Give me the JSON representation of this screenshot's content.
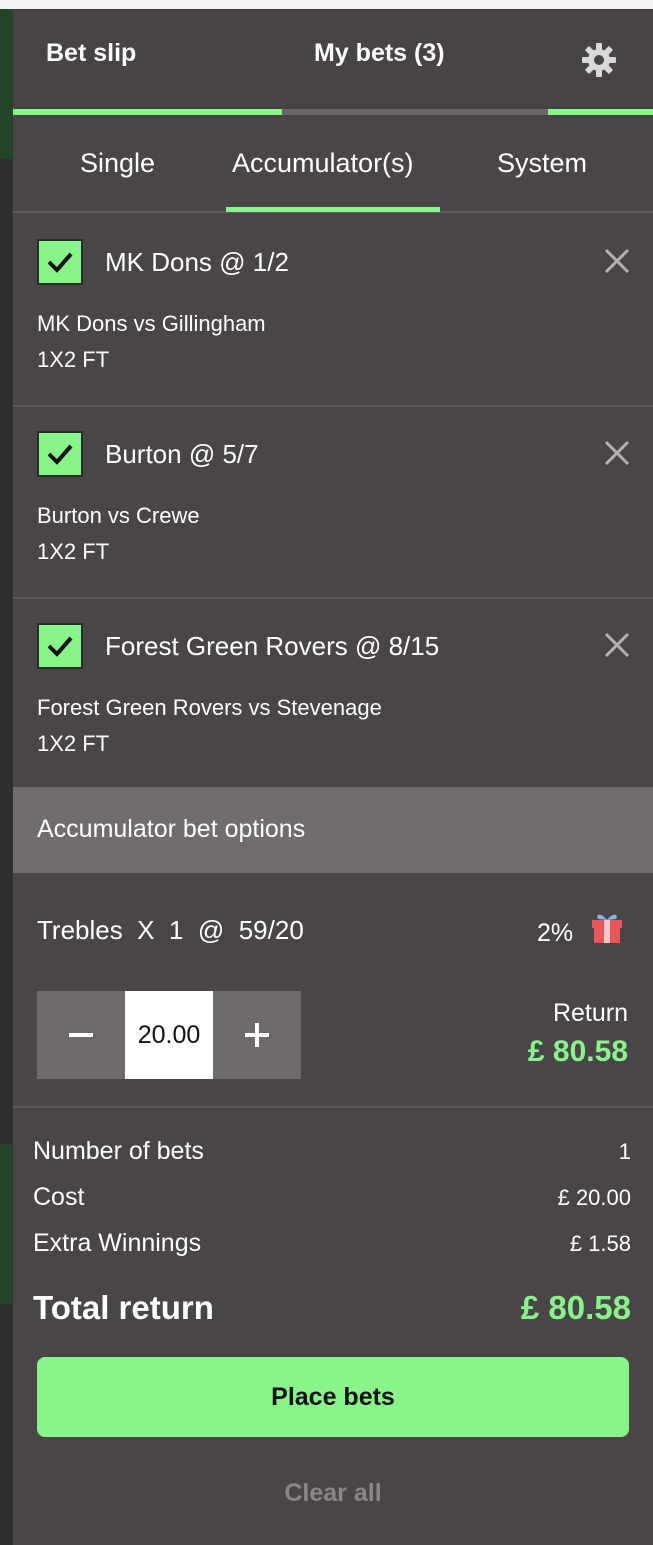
{
  "header": {
    "tab_betslip": "Bet slip",
    "tab_mybets": "My bets (3)",
    "settings_icon": "gear-icon",
    "accent": "#88f58a"
  },
  "subtabs": [
    "Single",
    "Accumulator(s)",
    "System"
  ],
  "selections": [
    {
      "title": "MK Dons @ 1/2",
      "match": "MK Dons vs Gillingham",
      "market": "1X2 FT"
    },
    {
      "title": "Burton @ 5/7",
      "match": "Burton vs Crewe",
      "market": "1X2 FT"
    },
    {
      "title": "Forest Green Rovers @ 8/15",
      "match": "Forest Green Rovers vs Stevenage",
      "market": "1X2 FT"
    }
  ],
  "options": {
    "header": "Accumulator bet options",
    "trebles": "Trebles  X  1  @  59/20",
    "boost_pct": "2%",
    "stake": "20.00",
    "return_label": "Return",
    "return_value": "£ 80.58"
  },
  "summary": {
    "bets_label": "Number of bets",
    "bets_value": "1",
    "cost_label": "Cost",
    "cost_value": "£ 20.00",
    "extra_label": "Extra Winnings",
    "extra_value": "£ 1.58",
    "total_label": "Total return",
    "total_value": "£ 80.58"
  },
  "actions": {
    "place": "Place bets",
    "clear": "Clear all"
  }
}
